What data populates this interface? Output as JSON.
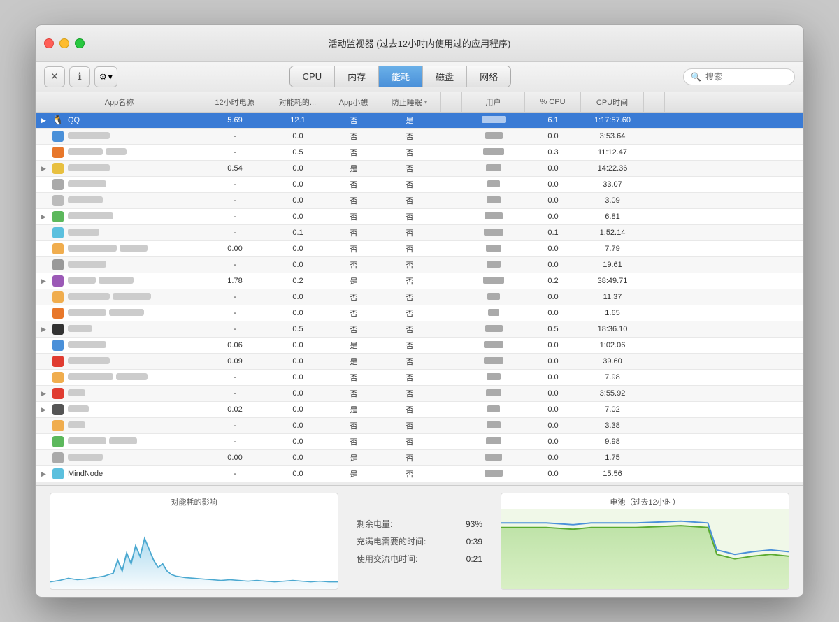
{
  "window": {
    "title": "活动监视器 (过去12小时内使用过的应用程序)"
  },
  "toolbar": {
    "close_label": "✕",
    "min_label": "−",
    "max_label": "+",
    "gear_label": "⚙",
    "gear_arrow": "▾",
    "search_placeholder": "搜索"
  },
  "tabs": [
    {
      "id": "cpu",
      "label": "CPU"
    },
    {
      "id": "memory",
      "label": "内存"
    },
    {
      "id": "energy",
      "label": "能耗",
      "active": true
    },
    {
      "id": "disk",
      "label": "磁盘"
    },
    {
      "id": "network",
      "label": "网络"
    }
  ],
  "columns": [
    {
      "id": "app-name",
      "label": "App名称"
    },
    {
      "id": "12h-power",
      "label": "12小时电源"
    },
    {
      "id": "energy-impact",
      "label": "对能耗的..."
    },
    {
      "id": "app-nap",
      "label": "App小憩"
    },
    {
      "id": "prevent-sleep",
      "label": "防止睡眠"
    },
    {
      "id": "sort-arrow",
      "label": "▾"
    },
    {
      "id": "user",
      "label": "用户"
    },
    {
      "id": "cpu-pct",
      "label": "% CPU"
    },
    {
      "id": "cpu-time",
      "label": "CPU时间"
    },
    {
      "id": "extra",
      "label": ""
    }
  ],
  "rows": [
    {
      "id": 1,
      "selected": true,
      "expand": true,
      "app": "QQ",
      "icon": "🐧",
      "icon_color": "#1a1a1a",
      "power12h": "5.69",
      "energy": "12.1",
      "nap": "否",
      "sleep": "是",
      "user_w": 35,
      "cpu": "6.1",
      "time": "1:17:57.60"
    },
    {
      "id": 2,
      "selected": false,
      "expand": false,
      "app": "b1",
      "w1": 60,
      "icon_color": "#4a90d9",
      "power12h": "-",
      "energy": "0.0",
      "nap": "否",
      "sleep": "否",
      "user_w": 25,
      "cpu": "0.0",
      "time": "3:53.64"
    },
    {
      "id": 3,
      "selected": false,
      "expand": false,
      "app": "b2",
      "w1": 50,
      "w2": 30,
      "icon_color": "#e8772a",
      "power12h": "-",
      "energy": "0.5",
      "nap": "否",
      "sleep": "否",
      "user_w": 30,
      "cpu": "0.3",
      "time": "11:12.47"
    },
    {
      "id": 4,
      "selected": false,
      "expand": true,
      "app": "b3",
      "w1": 60,
      "icon_color": "#e8c040",
      "power12h": "0.54",
      "energy": "0.0",
      "nap": "是",
      "sleep": "否",
      "user_w": 22,
      "cpu": "0.0",
      "time": "14:22.36"
    },
    {
      "id": 5,
      "selected": false,
      "expand": false,
      "app": "b4",
      "w1": 55,
      "icon_color": "#aaa",
      "power12h": "-",
      "energy": "0.0",
      "nap": "否",
      "sleep": "否",
      "user_w": 18,
      "cpu": "0.0",
      "time": "33.07"
    },
    {
      "id": 6,
      "selected": false,
      "expand": false,
      "app": "b5",
      "w1": 50,
      "icon_color": "#bbb",
      "power12h": "-",
      "energy": "0.0",
      "nap": "否",
      "sleep": "否",
      "user_w": 20,
      "cpu": "0.0",
      "time": "3.09"
    },
    {
      "id": 7,
      "selected": false,
      "expand": true,
      "app": "b6",
      "w1": 65,
      "icon_color": "#5cb85c",
      "power12h": "-",
      "energy": "0.0",
      "nap": "否",
      "sleep": "否",
      "user_w": 26,
      "cpu": "0.0",
      "time": "6.81"
    },
    {
      "id": 8,
      "selected": false,
      "expand": false,
      "app": "b7",
      "w1": 45,
      "icon_color": "#5bc0de",
      "power12h": "-",
      "energy": "0.1",
      "nap": "否",
      "sleep": "否",
      "user_w": 28,
      "cpu": "0.1",
      "time": "1:52.14"
    },
    {
      "id": 9,
      "selected": false,
      "expand": false,
      "app": "b8",
      "w1": 70,
      "w2": 40,
      "icon_color": "#f0ad4e",
      "power12h": "0.00",
      "energy": "0.0",
      "nap": "否",
      "sleep": "否",
      "user_w": 22,
      "cpu": "0.0",
      "time": "7.79"
    },
    {
      "id": 10,
      "selected": false,
      "expand": false,
      "app": "b9",
      "w1": 55,
      "icon_color": "#999",
      "power12h": "-",
      "energy": "0.0",
      "nap": "否",
      "sleep": "否",
      "user_w": 20,
      "cpu": "0.0",
      "time": "19.61"
    },
    {
      "id": 11,
      "selected": false,
      "expand": true,
      "app": "b10",
      "w1": 40,
      "w2": 50,
      "icon_color": "#9b59b6",
      "power12h": "1.78",
      "energy": "0.2",
      "nap": "是",
      "sleep": "否",
      "user_w": 30,
      "cpu": "0.2",
      "time": "38:49.71"
    },
    {
      "id": 12,
      "selected": false,
      "expand": false,
      "app": "b11",
      "w1": 60,
      "w2": 55,
      "icon_color": "#f0ad4e",
      "power12h": "-",
      "energy": "0.0",
      "nap": "否",
      "sleep": "否",
      "user_w": 18,
      "cpu": "0.0",
      "time": "11.37"
    },
    {
      "id": 13,
      "selected": false,
      "expand": false,
      "app": "b12",
      "w1": 55,
      "w2": 50,
      "icon_color": "#e8772a",
      "power12h": "-",
      "energy": "0.0",
      "nap": "否",
      "sleep": "否",
      "user_w": 16,
      "cpu": "0.0",
      "time": "1.65"
    },
    {
      "id": 14,
      "selected": false,
      "expand": true,
      "app": "b13",
      "w1": 35,
      "icon_color": "#333",
      "power12h": "-",
      "energy": "0.5",
      "nap": "否",
      "sleep": "否",
      "user_w": 25,
      "cpu": "0.5",
      "time": "18:36.10"
    },
    {
      "id": 15,
      "selected": false,
      "expand": false,
      "app": "b14",
      "w1": 55,
      "icon_color": "#4a90d9",
      "power12h": "0.06",
      "energy": "0.0",
      "nap": "是",
      "sleep": "否",
      "user_w": 28,
      "cpu": "0.0",
      "time": "1:02.06"
    },
    {
      "id": 16,
      "selected": false,
      "expand": false,
      "app": "b15",
      "w1": 60,
      "icon_color": "#e03c31",
      "power12h": "0.09",
      "energy": "0.0",
      "nap": "是",
      "sleep": "否",
      "user_w": 28,
      "cpu": "0.0",
      "time": "39.60"
    },
    {
      "id": 17,
      "selected": false,
      "expand": false,
      "app": "b16",
      "w1": 65,
      "w2": 45,
      "icon_color": "#f0ad4e",
      "power12h": "-",
      "energy": "0.0",
      "nap": "否",
      "sleep": "否",
      "user_w": 20,
      "cpu": "0.0",
      "time": "7.98"
    },
    {
      "id": 18,
      "selected": false,
      "expand": true,
      "app": "b17",
      "w1": 25,
      "icon_color": "#e03c31",
      "power12h": "-",
      "energy": "0.0",
      "nap": "否",
      "sleep": "否",
      "user_w": 22,
      "cpu": "0.0",
      "time": "3:55.92"
    },
    {
      "id": 19,
      "selected": false,
      "expand": true,
      "app": "b18",
      "w1": 30,
      "icon_color": "#555",
      "power12h": "0.02",
      "energy": "0.0",
      "nap": "是",
      "sleep": "否",
      "user_w": 18,
      "cpu": "0.0",
      "time": "7.02"
    },
    {
      "id": 20,
      "selected": false,
      "expand": false,
      "app": "b19",
      "w1": 25,
      "icon_color": "#f0ad4e",
      "power12h": "-",
      "energy": "0.0",
      "nap": "否",
      "sleep": "否",
      "user_w": 20,
      "cpu": "0.0",
      "time": "3.38"
    },
    {
      "id": 21,
      "selected": false,
      "expand": false,
      "app": "b20",
      "w1": 55,
      "w2": 40,
      "icon_color": "#5cb85c",
      "power12h": "-",
      "energy": "0.0",
      "nap": "否",
      "sleep": "否",
      "user_w": 22,
      "cpu": "0.0",
      "time": "9.98"
    },
    {
      "id": 22,
      "selected": false,
      "expand": false,
      "app": "b21",
      "w1": 50,
      "icon_color": "#aaa",
      "power12h": "0.00",
      "energy": "0.0",
      "nap": "是",
      "sleep": "否",
      "user_w": 24,
      "cpu": "0.0",
      "time": "1.75"
    },
    {
      "id": 23,
      "selected": false,
      "expand": true,
      "app": "MindNode",
      "w1": 55,
      "icon_color": "#5bc0de",
      "power12h": "-",
      "energy": "0.0",
      "nap": "是",
      "sleep": "否",
      "user_w": 26,
      "cpu": "0.0",
      "time": "15.56"
    }
  ],
  "bottom": {
    "energy_title": "对能耗的影响",
    "battery_title": "电池（过去12小时）",
    "stats": [
      {
        "label": "剩余电量:",
        "value": "93%"
      },
      {
        "label": "充满电需要的时间:",
        "value": "0:39"
      },
      {
        "label": "使用交流电时间:",
        "value": "0:21"
      }
    ]
  }
}
